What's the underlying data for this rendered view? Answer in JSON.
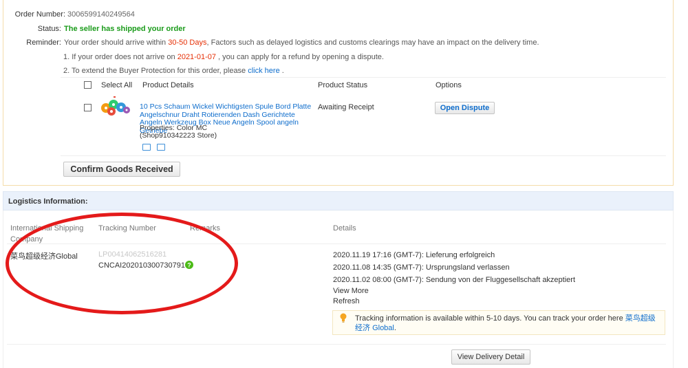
{
  "order": {
    "number_label": "Order Number:",
    "number_value": "3006599140249564",
    "status_label": "Status:",
    "status_value": "The seller has shipped your order",
    "reminder_label": "Reminder:",
    "reminder_pre": "Your order should arrive within ",
    "reminder_days": "30-50 Days",
    "reminder_post": ", Factors such as delayed logistics and customs clearings may have an impact on the delivery time.",
    "note1_pre": "1. If your order does not arrive on ",
    "note1_date": "2021-01-07",
    "note1_post": " , you can apply for a refund by opening a dispute.",
    "note2_pre": "2. To extend the Buyer Protection for this order, please ",
    "note2_link": "click here",
    "note2_post": " ."
  },
  "products": {
    "headers": {
      "select_all": "Select All",
      "details": "Product Details",
      "status": "Product Status",
      "options": "Options"
    },
    "item": {
      "title": "10 Pcs Schaum Wickel Wichtigsten Spule Bord Platte Angelschnur Draht Rotierenden Dash Gerichtete Angeln Werkzeug Box Neue Angeln Spool angeln Getriebe",
      "properties": "Properties: Color MC",
      "store": "(Shop910342223 Store)",
      "status": "Awaiting Receipt",
      "dispute_label": "Open Dispute"
    },
    "confirm_label": "Confirm Goods Received"
  },
  "logistics": {
    "title": "Logistics Information:",
    "headers": {
      "company": "International Shipping Company",
      "tracking": "Tracking Number",
      "remarks": "Remarks",
      "details": "Details"
    },
    "company": "菜鸟超级经济Global",
    "tracking_old": "LP00414062516281",
    "tracking_new": "CNCAI202010300730791 7",
    "events": [
      "2020.11.19 17:16 (GMT-7): Lieferung erfolgreich",
      "2020.11.08 14:35 (GMT-7): Ursprungsland verlassen",
      "2020.11.02 08:00 (GMT-7): Sendung von der Fluggesellschaft akzeptiert"
    ],
    "view_more": "View More",
    "refresh": "Refresh",
    "tip_text": "Tracking information is available within 5-10 days. You can track your order here ",
    "tip_link_1": "菜鸟超级经济",
    "tip_link_2": "Global",
    "tip_end": ".",
    "delivery_detail_label": "View Delivery Detail"
  },
  "colors": {
    "status_green": "#1a9b1a",
    "alert_red": "#e62e04",
    "link_blue": "#0e6dcc",
    "annotation_red": "#e41a1a"
  }
}
